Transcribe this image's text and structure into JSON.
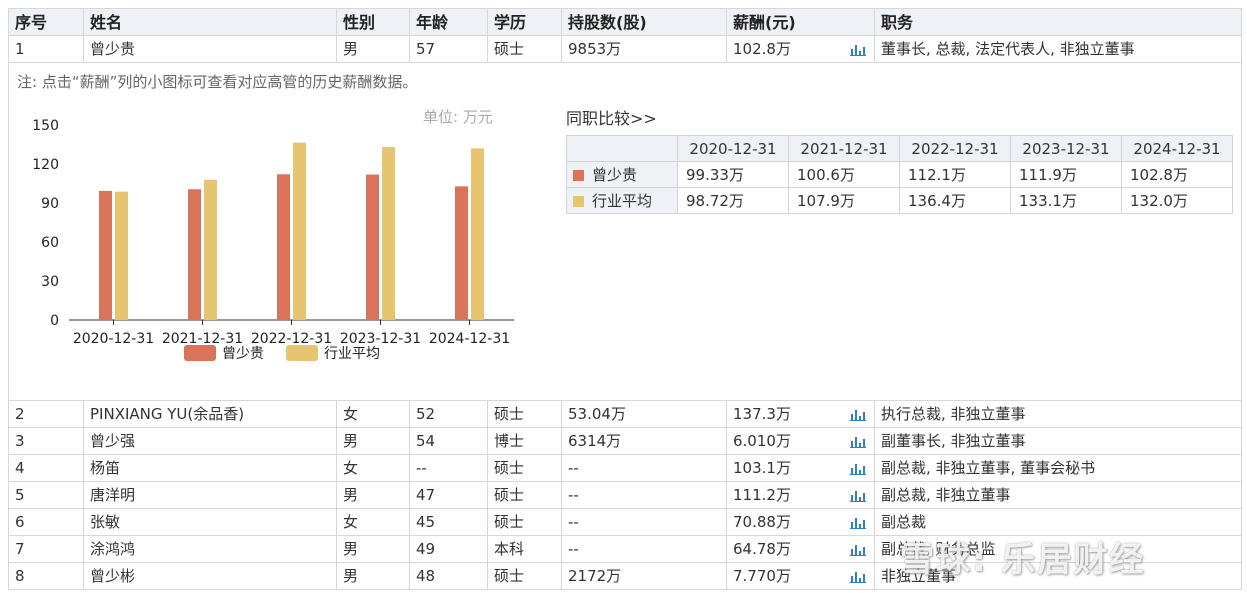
{
  "columns": {
    "index": "序号",
    "name": "姓名",
    "gender": "性别",
    "age": "年龄",
    "education": "学历",
    "shares": "持股数(股)",
    "salary": "薪酬(元)",
    "position": "职务"
  },
  "rows": [
    {
      "index": "1",
      "name": "曾少贵",
      "gender": "男",
      "age": "57",
      "education": "硕士",
      "shares": "9853万",
      "salary": "102.8万",
      "position": "董事长, 总裁, 法定代表人, 非独立董事"
    },
    {
      "index": "2",
      "name": "PINXIANG YU(余品香)",
      "gender": "女",
      "age": "52",
      "education": "硕士",
      "shares": "53.04万",
      "salary": "137.3万",
      "position": "执行总裁, 非独立董事"
    },
    {
      "index": "3",
      "name": "曾少强",
      "gender": "男",
      "age": "54",
      "education": "博士",
      "shares": "6314万",
      "salary": "6.010万",
      "position": "副董事长, 非独立董事"
    },
    {
      "index": "4",
      "name": "杨笛",
      "gender": "女",
      "age": "--",
      "education": "硕士",
      "shares": "--",
      "salary": "103.1万",
      "position": "副总裁, 非独立董事, 董事会秘书"
    },
    {
      "index": "5",
      "name": "唐洋明",
      "gender": "男",
      "age": "47",
      "education": "硕士",
      "shares": "--",
      "salary": "111.2万",
      "position": "副总裁, 非独立董事"
    },
    {
      "index": "6",
      "name": "张敏",
      "gender": "女",
      "age": "45",
      "education": "硕士",
      "shares": "--",
      "salary": "70.88万",
      "position": "副总裁"
    },
    {
      "index": "7",
      "name": "涂鸿鸿",
      "gender": "男",
      "age": "49",
      "education": "本科",
      "shares": "--",
      "salary": "64.78万",
      "position": "副总裁, 财务总监"
    },
    {
      "index": "8",
      "name": "曾少彬",
      "gender": "男",
      "age": "48",
      "education": "硕士",
      "shares": "2172万",
      "salary": "7.770万",
      "position": "非独立董事"
    }
  ],
  "detail": {
    "note": "注: 点击“薪酬”列的小图标可查看对应高管的历史薪酬数据。",
    "unit": "单位: 万元",
    "compare_title": "同职比较>>",
    "years": [
      "2020-12-31",
      "2021-12-31",
      "2022-12-31",
      "2023-12-31",
      "2024-12-31"
    ],
    "compare_rows": [
      {
        "name": "曾少贵",
        "values": [
          "99.33万",
          "100.6万",
          "112.1万",
          "111.9万",
          "102.8万"
        ]
      },
      {
        "name": "行业平均",
        "values": [
          "98.72万",
          "107.9万",
          "136.4万",
          "133.1万",
          "132.0万"
        ]
      }
    ]
  },
  "chart_data": {
    "type": "bar",
    "categories": [
      "2020-12-31",
      "2021-12-31",
      "2022-12-31",
      "2023-12-31",
      "2024-12-31"
    ],
    "series": [
      {
        "name": "曾少贵",
        "values": [
          99.33,
          100.6,
          112.1,
          111.9,
          102.8
        ],
        "color": "#d9735a"
      },
      {
        "name": "行业平均",
        "values": [
          98.72,
          107.9,
          136.4,
          133.1,
          132.0
        ],
        "color": "#e6c470"
      }
    ],
    "ylim": [
      0,
      150
    ],
    "yticks": [
      0,
      30,
      60,
      90,
      120,
      150
    ],
    "legend": "bottom",
    "grid": false
  },
  "watermark": "雪球: 乐居财经",
  "colors": {
    "header_bg": "#eef1f5",
    "border": "#d7d7d7",
    "icon": "#2f7fd1"
  }
}
